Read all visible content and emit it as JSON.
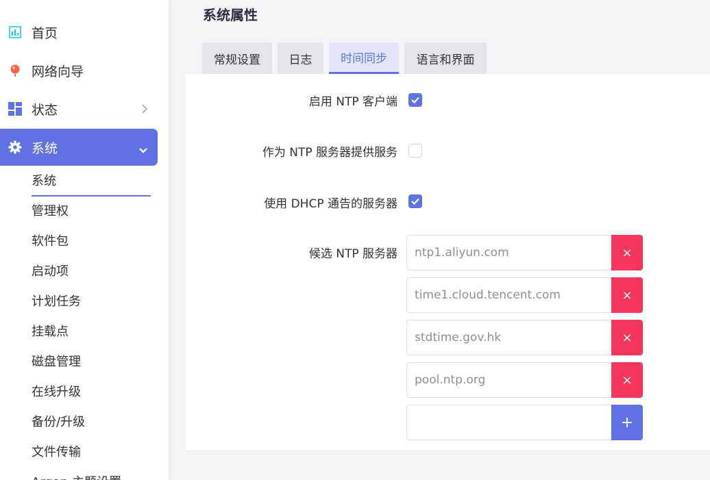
{
  "sidebar": {
    "items": [
      {
        "label": "首页",
        "icon": "dashboard-icon"
      },
      {
        "label": "网络向导",
        "icon": "globe-icon"
      },
      {
        "label": "状态",
        "icon": "grid-icon"
      },
      {
        "label": "系统",
        "icon": "gear-icon"
      }
    ],
    "sub_items": [
      "系统",
      "管理权",
      "软件包",
      "启动项",
      "计划任务",
      "挂载点",
      "磁盘管理",
      "在线升级",
      "备份/升级",
      "文件传输",
      "Argon 主题设置"
    ]
  },
  "page": {
    "title": "系统属性",
    "tabs": [
      "常规设置",
      "日志",
      "时间同步",
      "语言和界面"
    ],
    "active_tab": "时间同步"
  },
  "ntp": {
    "enable_client_label": "启用 NTP 客户端",
    "enable_client": true,
    "provide_server_label": "作为 NTP 服务器提供服务",
    "provide_server": false,
    "use_dhcp_label": "使用 DHCP 通告的服务器",
    "use_dhcp": true,
    "candidates_label": "候选 NTP 服务器",
    "servers": [
      "ntp1.aliyun.com",
      "time1.cloud.tencent.com",
      "stdtime.gov.hk",
      "pool.ntp.org"
    ],
    "new_server": "",
    "remove_symbol": "×",
    "add_symbol": "+"
  },
  "colors": {
    "accent": "#5e72e4",
    "danger": "#f5365c"
  }
}
